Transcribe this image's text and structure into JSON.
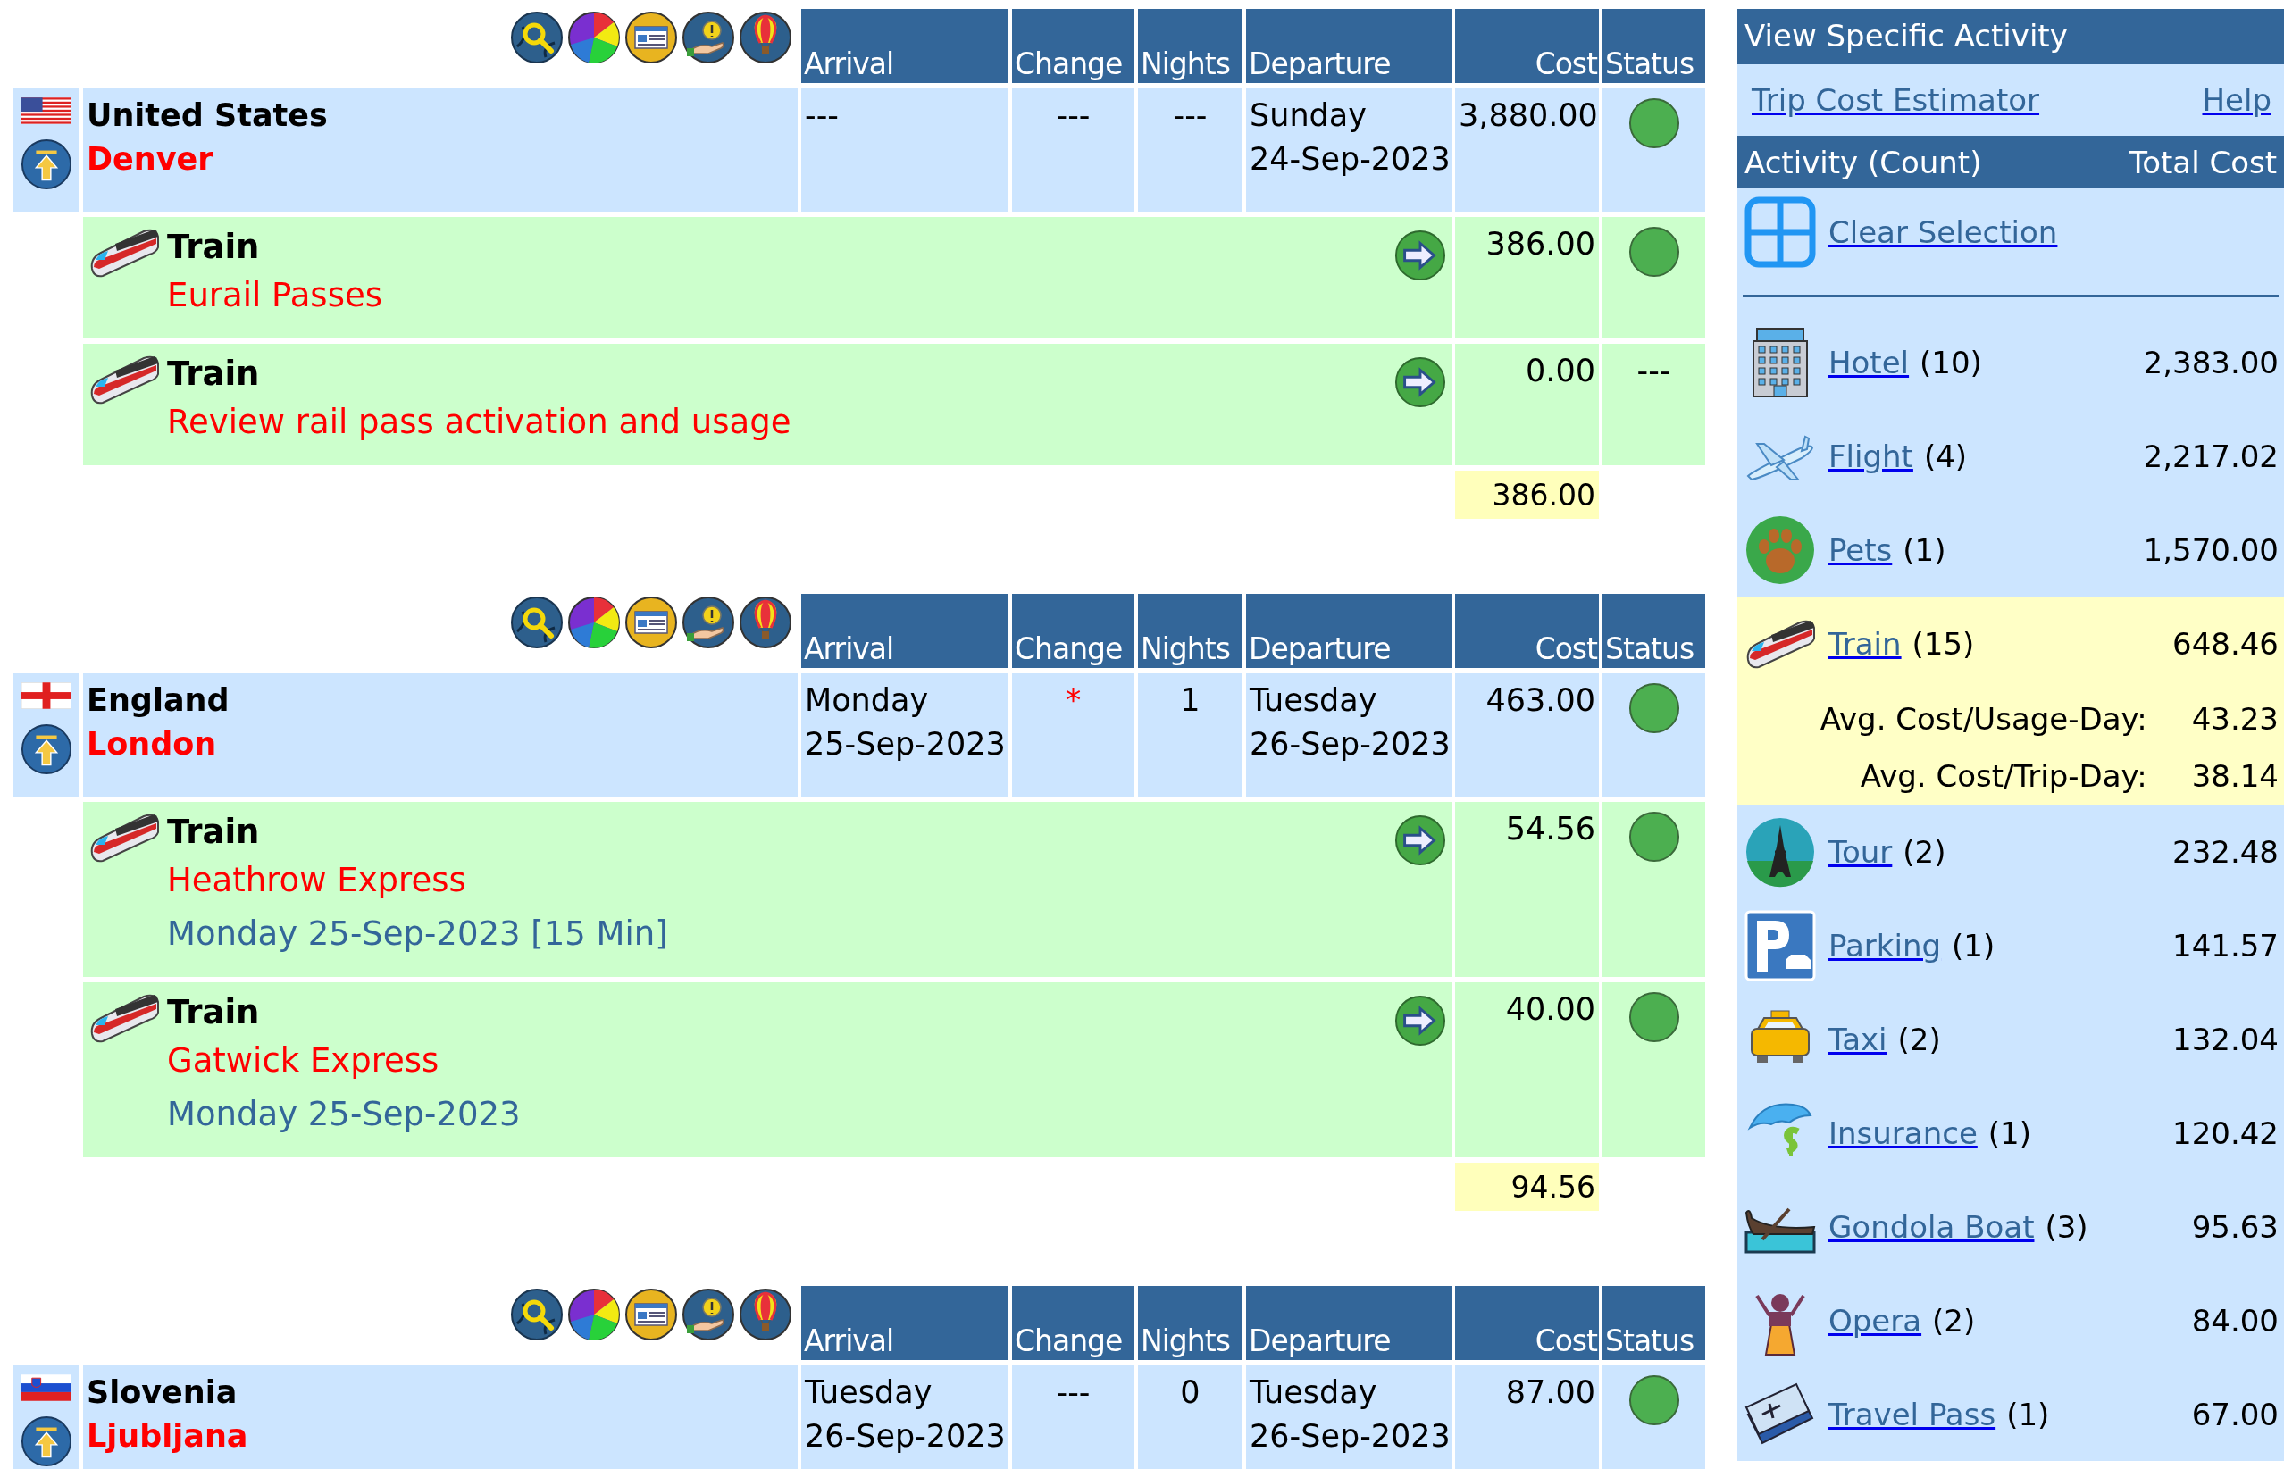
{
  "sections": [
    {
      "columns": [
        "Arrival",
        "Change",
        "Nights",
        "Departure",
        "Cost",
        "Status"
      ],
      "location": {
        "kind": "us",
        "country": "United States",
        "city": "Denver",
        "arrival": [
          "---"
        ],
        "change": {
          "text": "---",
          "alert": false
        },
        "nights": "---",
        "departure": [
          "Sunday",
          "24-Sep-2023"
        ],
        "cost": "3,880.00",
        "status": {
          "kind": "dot"
        }
      },
      "activities": [
        {
          "kind": "train",
          "type": "Train",
          "description": "Eurail Passes",
          "cost": "386.00",
          "status": {
            "kind": "dot"
          }
        },
        {
          "kind": "train",
          "type": "Train",
          "description": "Review rail pass activation and usage",
          "cost": "0.00",
          "status": {
            "kind": "text",
            "text": "---"
          }
        }
      ],
      "subtotal": "386.00"
    },
    {
      "columns": [
        "Arrival",
        "Change",
        "Nights",
        "Departure",
        "Cost",
        "Status"
      ],
      "location": {
        "kind": "england",
        "country": "England",
        "city": "London",
        "arrival": [
          "Monday",
          "25-Sep-2023"
        ],
        "change": {
          "text": "*",
          "alert": true
        },
        "nights": "1",
        "departure": [
          "Tuesday",
          "26-Sep-2023"
        ],
        "cost": "463.00",
        "status": {
          "kind": "dot"
        }
      },
      "activities": [
        {
          "kind": "train",
          "type": "Train",
          "description": "Heathrow Express",
          "detail": "Monday 25-Sep-2023 [15 Min]",
          "cost": "54.56",
          "status": {
            "kind": "dot"
          }
        },
        {
          "kind": "train",
          "type": "Train",
          "description": "Gatwick Express",
          "detail": "Monday 25-Sep-2023",
          "cost": "40.00",
          "status": {
            "kind": "dot"
          }
        }
      ],
      "subtotal": "94.56"
    },
    {
      "columns": [
        "Arrival",
        "Change",
        "Nights",
        "Departure",
        "Cost",
        "Status"
      ],
      "location": {
        "kind": "slovenia",
        "country": "Slovenia",
        "city": "Ljubljana",
        "arrival": [
          "Tuesday",
          "26-Sep-2023"
        ],
        "change": {
          "text": "---",
          "alert": false
        },
        "nights": "0",
        "departure": [
          "Tuesday",
          "26-Sep-2023"
        ],
        "cost": "87.00",
        "status": {
          "kind": "dot"
        }
      }
    }
  ],
  "sidebar": {
    "title": "View Specific Activity",
    "links": [
      "Trip Cost Estimator",
      "Help"
    ],
    "header": {
      "activity": "Activity (Count)",
      "total": "Total Cost"
    },
    "clear_selection": "Clear Selection",
    "activities": [
      {
        "kind": "hotel",
        "name": "Hotel",
        "count": "(10)",
        "total": "2,383.00",
        "selected": false
      },
      {
        "kind": "flight",
        "name": "Flight",
        "count": "(4)",
        "total": "2,217.02",
        "selected": false
      },
      {
        "kind": "pets",
        "name": "Pets",
        "count": "(1)",
        "total": "1,570.00",
        "selected": false
      },
      {
        "kind": "train",
        "name": "Train",
        "count": "(15)",
        "total": "648.46",
        "selected": true,
        "stats": [
          {
            "label": "Avg. Cost/Usage-Day:",
            "value": "43.23"
          },
          {
            "label": "Avg. Cost/Trip-Day:",
            "value": "38.14"
          }
        ]
      },
      {
        "kind": "tour",
        "name": "Tour",
        "count": "(2)",
        "total": "232.48",
        "selected": false
      },
      {
        "kind": "parking",
        "name": "Parking",
        "count": "(1)",
        "total": "141.57",
        "selected": false
      },
      {
        "kind": "taxi",
        "name": "Taxi",
        "count": "(2)",
        "total": "132.04",
        "selected": false
      },
      {
        "kind": "insurance",
        "name": "Insurance",
        "count": "(1)",
        "total": "120.42",
        "selected": false
      },
      {
        "kind": "gondola",
        "name": "Gondola Boat",
        "count": "(3)",
        "total": "95.63",
        "selected": false
      },
      {
        "kind": "opera",
        "name": "Opera",
        "count": "(2)",
        "total": "84.00",
        "selected": false
      },
      {
        "kind": "pass",
        "name": "Travel Pass",
        "count": "(1)",
        "total": "67.00",
        "selected": false
      }
    ]
  }
}
